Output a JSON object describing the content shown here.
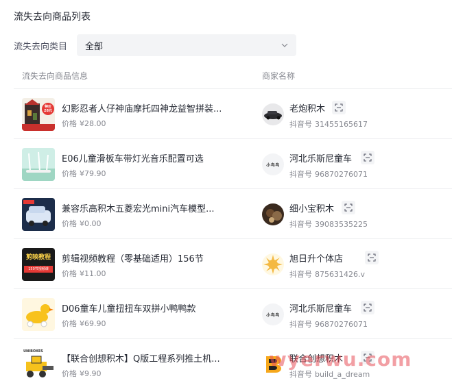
{
  "page": {
    "title": "流失去向商品列表"
  },
  "filter": {
    "label": "流失去向类目",
    "value": "全部"
  },
  "table": {
    "headers": {
      "goods": "流失去向商品信息",
      "shop": "商家名称"
    },
    "price_label": "价格",
    "id_label": "抖音号",
    "rows": [
      {
        "title": "幻影忍者人仔神庙摩托四神龙益智拼装...",
        "price": "¥28.00",
        "shop": "老炮积木",
        "shop_id": "31455165617",
        "thumb_text": "特价 28元"
      },
      {
        "title": "E06儿童滑板车带灯光音乐配置可选",
        "price": "¥79.90",
        "shop": "河北乐斯尼童车",
        "shop_id": "96870276071",
        "avatar_text": "小鸟鸟"
      },
      {
        "title": "兼容乐高积木五菱宏光mini汽车模型...",
        "price": "¥0.00",
        "shop": "细小宝积木",
        "shop_id": "39083535225"
      },
      {
        "title": "剪辑视频教程（零基础适用）156节",
        "price": "¥11.00",
        "shop": "旭日升个体店",
        "shop_id": "875631426.v",
        "thumb_text": "剪映教程",
        "thumb_sub": "150节视频课"
      },
      {
        "title": "D06童车儿童扭扭车双拼小鸭鸭款",
        "price": "¥69.90",
        "shop": "河北乐斯尼童车",
        "shop_id": "96870276071",
        "avatar_text": "小鸟鸟"
      },
      {
        "title": "【联合创想积木】Q版工程系列推土机...",
        "price": "¥9.90",
        "shop": "联合创想积木",
        "shop_id": "build_a_dream",
        "thumb_text": "UNIBOXES"
      }
    ]
  },
  "watermark": "wyerwu.com",
  "colors": {
    "text": "#252933",
    "muted": "#85878f",
    "divider": "#eeeff1",
    "select_bg": "#f3f4f6"
  }
}
